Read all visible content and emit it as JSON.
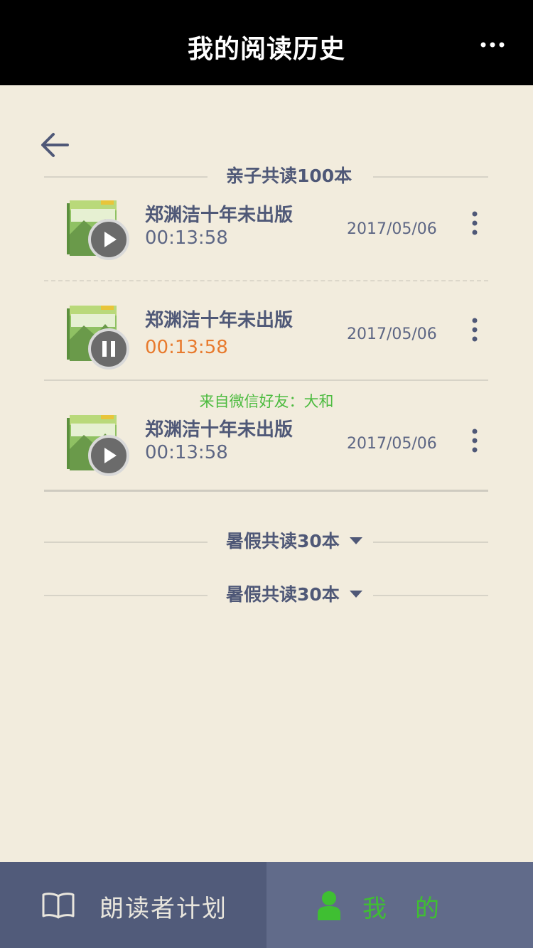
{
  "header": {
    "title": "我的阅读历史",
    "more_icon": "more-dots-icon"
  },
  "nav": {
    "back_icon": "back-arrow-icon"
  },
  "sections": [
    {
      "label": "亲子共读100本",
      "items": [
        {
          "title": "郑渊洁十年未出版",
          "duration": "00:13:58",
          "date": "2017/05/06",
          "state": "play"
        },
        {
          "title": "郑渊洁十年未出版",
          "duration": "00:13:58",
          "date": "2017/05/06",
          "state": "pause"
        },
        {
          "title": "郑渊洁十年未出版",
          "duration": "00:13:58",
          "date": "2017/05/06",
          "state": "play",
          "source": "来自微信好友：大和"
        }
      ]
    },
    {
      "label": "暑假共读30本",
      "collapsed": true
    },
    {
      "label": "暑假共读30本",
      "collapsed": true
    }
  ],
  "tabbar": {
    "tabs": [
      {
        "label": "朗读者计划",
        "icon": "book-icon",
        "active": false
      },
      {
        "label": "我的",
        "icon": "user-icon",
        "active": true
      }
    ]
  },
  "colors": {
    "background": "#f2ecdd",
    "header": "#000000",
    "text": "#4f5877",
    "playing_time": "#e87a2d",
    "source_text": "#4cbb3f",
    "tab_active": "#3fbf32",
    "tabbar": "#515b7a"
  }
}
